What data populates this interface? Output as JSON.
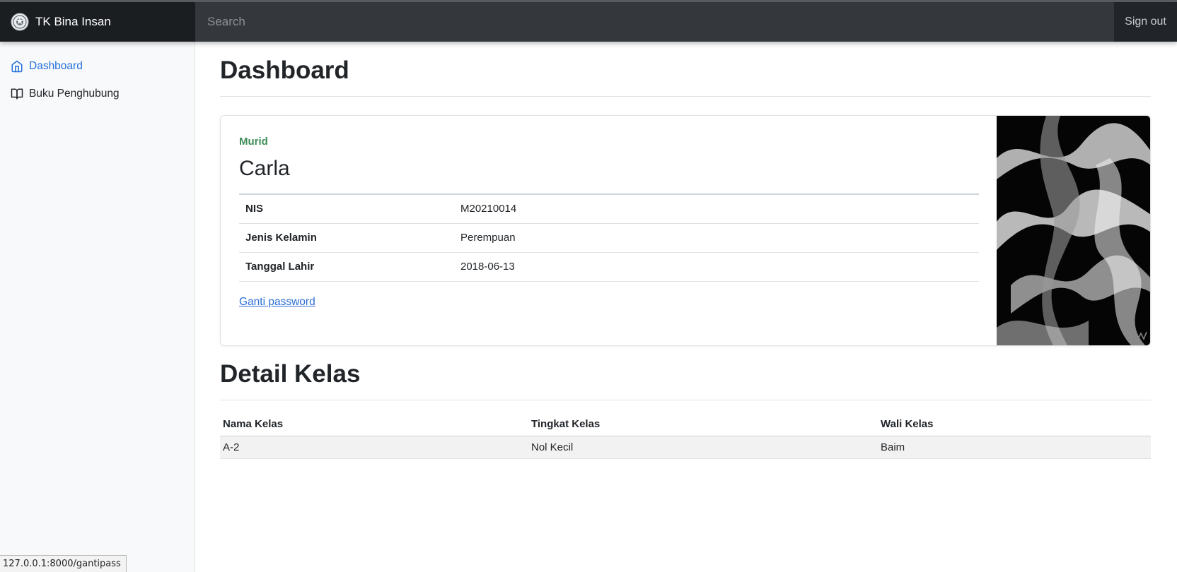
{
  "navbar": {
    "brand": "TK Bina Insan",
    "search_placeholder": "Search",
    "signout_label": "Sign out"
  },
  "sidebar": {
    "items": [
      {
        "label": "Dashboard",
        "icon": "home-icon",
        "active": true
      },
      {
        "label": "Buku Penghubung",
        "icon": "book-icon",
        "active": false
      }
    ]
  },
  "main": {
    "title": "Dashboard",
    "profile": {
      "role": "Murid",
      "name": "Carla",
      "rows": [
        {
          "label": "NIS",
          "value": "M20210014"
        },
        {
          "label": "Jenis Kelamin",
          "value": "Perempuan"
        },
        {
          "label": "Tanggal Lahir",
          "value": "2018-06-13"
        }
      ],
      "link": "Ganti password"
    },
    "class_section": {
      "title": "Detail Kelas",
      "headers": [
        "Nama Kelas",
        "Tingkat Kelas",
        "Wali Kelas"
      ],
      "rows": [
        [
          "A-2",
          "Nol Kecil",
          "Baim"
        ]
      ]
    }
  },
  "status_url": "127.0.0.1:8000/gantipass",
  "colors": {
    "accent": "#2470dc",
    "role_green": "#3f8f5a",
    "navbar_bg": "#212529"
  }
}
